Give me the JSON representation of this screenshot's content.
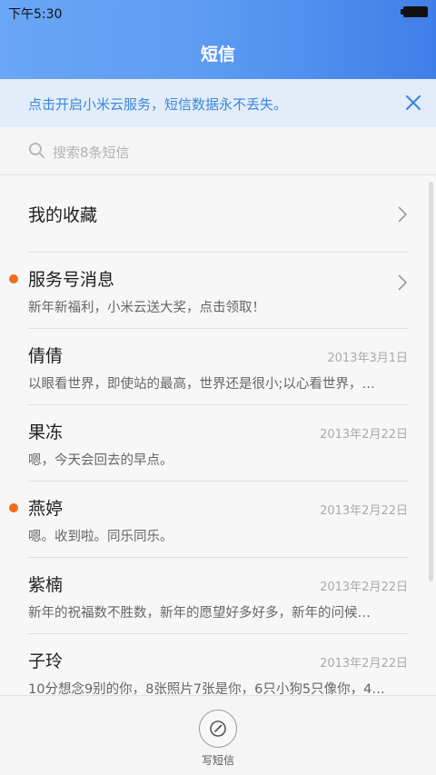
{
  "status_bar": {
    "time": "下午5:30"
  },
  "header": {
    "title": "短信"
  },
  "notice": {
    "text": "点击开启小米云服务，短信数据永不丢失。"
  },
  "search": {
    "placeholder": "搜索8条短信"
  },
  "list": [
    {
      "title": "我的收藏",
      "subtitle": "",
      "date": "",
      "unread": false,
      "chevron": true
    },
    {
      "title": "服务号消息",
      "subtitle": "新年新福利，小米云送大奖，点击领取！",
      "date": "",
      "unread": true,
      "chevron": true
    },
    {
      "title": "倩倩",
      "subtitle": "以眼看世界，即使站的最高，世界还是很小;以心看世界，…",
      "date": "2013年3月1日",
      "unread": false,
      "chevron": false
    },
    {
      "title": "果冻",
      "subtitle": "嗯，今天会回去的早点。",
      "date": "2013年2月22日",
      "unread": false,
      "chevron": false
    },
    {
      "title": "燕婷",
      "subtitle": "嗯。收到啦。同乐同乐。",
      "date": "2013年2月22日",
      "unread": true,
      "chevron": false
    },
    {
      "title": "紫楠",
      "subtitle": "新年的祝福数不胜数，新年的愿望好多好多，新年的问候…",
      "date": "2013年2月22日",
      "unread": false,
      "chevron": false
    },
    {
      "title": "子玲",
      "subtitle": "10分想念9别的你，8张照片7张是你，6只小狗5只像你，4…",
      "date": "2013年2月22日",
      "unread": false,
      "chevron": false
    }
  ],
  "bottom": {
    "compose_label": "写短信"
  },
  "colors": {
    "header_start": "#6aa6f5",
    "header_end": "#3f7fe8",
    "notice_text": "#3a86e0",
    "unread_dot": "#f56c1e"
  },
  "icons": {
    "notice_close": "close-icon",
    "search": "search-icon",
    "chevron": "chevron-right-icon",
    "compose": "compose-icon"
  }
}
